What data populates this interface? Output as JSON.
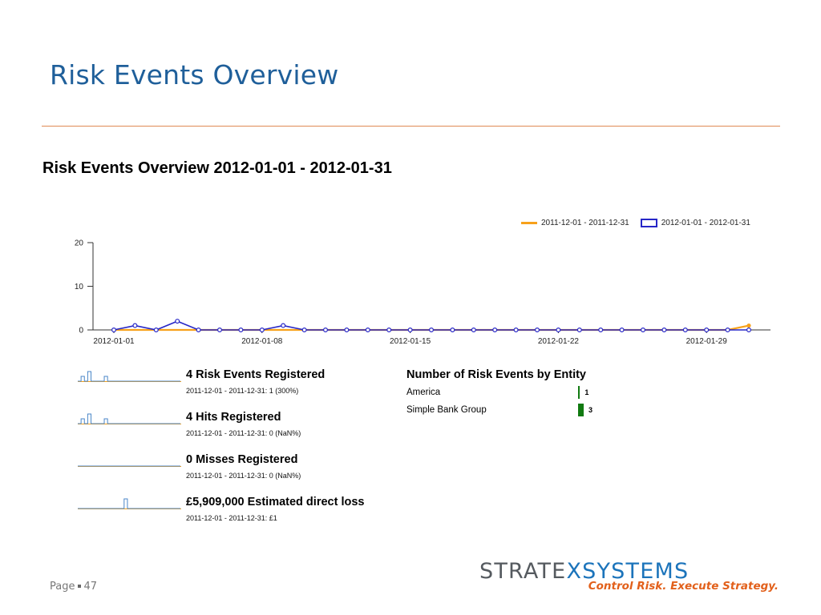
{
  "slide": {
    "title": "Risk Events Overview",
    "page_label": "Page",
    "page_number": "47"
  },
  "report": {
    "title": "Risk Events Overview 2012-01-01 - 2012-01-31"
  },
  "colors": {
    "title_blue": "#1f5f9a",
    "rule_orange": "#e08b55",
    "prior_series": "#f7a11a",
    "current_series": "#2626c7",
    "spark_blue": "#4a86c8",
    "entity_bar": "#117a11"
  },
  "chart_data": {
    "type": "line",
    "title": "",
    "xlabel": "",
    "ylabel": "",
    "ylim": [
      0,
      20
    ],
    "yticks": [
      0,
      10,
      20
    ],
    "xtick_labels": [
      "2012-01-01",
      "2012-01-08",
      "2012-01-15",
      "2012-01-22",
      "2012-01-29"
    ],
    "legend_position": "top-right",
    "series": [
      {
        "name": "2011-12-01 - 2011-12-31",
        "color": "#f7a11a",
        "values": [
          0,
          0,
          0,
          0,
          0,
          0,
          0,
          0,
          0,
          0,
          0,
          0,
          0,
          0,
          0,
          0,
          0,
          0,
          0,
          0,
          0,
          0,
          0,
          0,
          0,
          0,
          0,
          0,
          0,
          0,
          1
        ]
      },
      {
        "name": "2012-01-01 - 2012-01-31",
        "color": "#2626c7",
        "values": [
          0,
          1,
          0,
          2,
          0,
          0,
          0,
          0,
          1,
          0,
          0,
          0,
          0,
          0,
          0,
          0,
          0,
          0,
          0,
          0,
          0,
          0,
          0,
          0,
          0,
          0,
          0,
          0,
          0,
          0,
          0
        ]
      }
    ]
  },
  "stats": [
    {
      "title": "4 Risk Events Registered",
      "subtitle": "2011-12-01 - 2011-12-31: 1 (300%)",
      "spark": [
        0,
        1,
        0,
        2,
        0,
        0,
        0,
        0,
        1,
        0,
        0,
        0,
        0,
        0,
        0,
        0,
        0,
        0,
        0,
        0,
        0,
        0,
        0,
        0,
        0,
        0,
        0,
        0,
        0,
        0,
        0
      ]
    },
    {
      "title": "4 Hits Registered",
      "subtitle": "2011-12-01 - 2011-12-31: 0 (NaN%)",
      "spark": [
        0,
        1,
        0,
        2,
        0,
        0,
        0,
        0,
        1,
        0,
        0,
        0,
        0,
        0,
        0,
        0,
        0,
        0,
        0,
        0,
        0,
        0,
        0,
        0,
        0,
        0,
        0,
        0,
        0,
        0,
        0
      ]
    },
    {
      "title": "0 Misses Registered",
      "subtitle": "2011-12-01 - 2011-12-31: 0 (NaN%)",
      "spark": [
        0,
        0,
        0,
        0,
        0,
        0,
        0,
        0,
        0,
        0,
        0,
        0,
        0,
        0,
        0,
        0,
        0,
        0,
        0,
        0,
        0,
        0,
        0,
        0,
        0,
        0,
        0,
        0,
        0,
        0,
        0
      ]
    },
    {
      "title": "£5,909,000 Estimated direct loss",
      "subtitle": "2011-12-01 - 2011-12-31: £1",
      "spark": [
        0,
        0,
        0,
        0,
        0,
        0,
        0,
        0,
        0,
        0,
        0,
        0,
        0,
        0,
        2,
        0,
        0,
        0,
        0,
        0,
        0,
        0,
        0,
        0,
        0,
        0,
        0,
        0,
        0,
        0,
        0
      ]
    }
  ],
  "entities": {
    "title": "Number of Risk Events by Entity",
    "rows": [
      {
        "label": "America",
        "value": 1
      },
      {
        "label": "Simple Bank Group",
        "value": 3
      }
    ]
  },
  "logo": {
    "word_part1": "STRATE",
    "word_part2": "XSYSTEMS",
    "tagline": "Control Risk. Execute Strategy."
  }
}
